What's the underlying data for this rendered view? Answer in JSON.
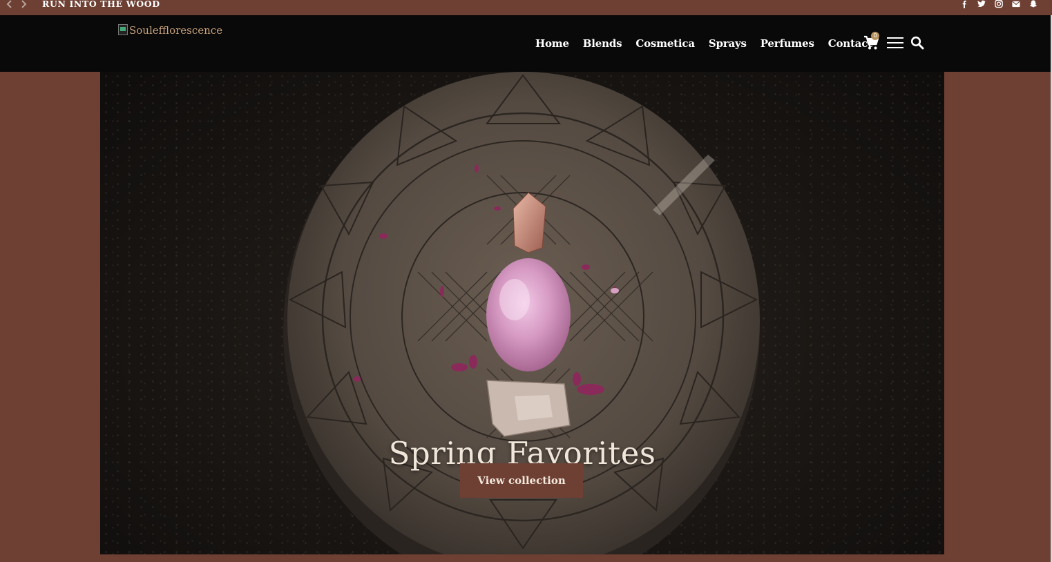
{
  "topbar": {
    "announcement": "RUN INTO THE WOOD",
    "prev_icon": "chevron-left-icon",
    "next_icon": "chevron-right-icon",
    "social_icons": [
      "facebook-icon",
      "twitter-icon",
      "instagram-icon",
      "envelope-icon",
      "snapchat-icon"
    ]
  },
  "header": {
    "logo_alt": "Soulefflorescence",
    "nav": [
      "Home",
      "Blends",
      "Cosmetica",
      "Sprays",
      "Perfumes",
      "Contact"
    ],
    "cart_count": "0"
  },
  "hero": {
    "title": "Spring Favorites",
    "button_label": "View collection"
  },
  "colors": {
    "brand_brown": "#6e3f33",
    "header_black": "#0a0909",
    "logo_gold": "#c6a17a",
    "badge_gold": "#b8935e"
  }
}
